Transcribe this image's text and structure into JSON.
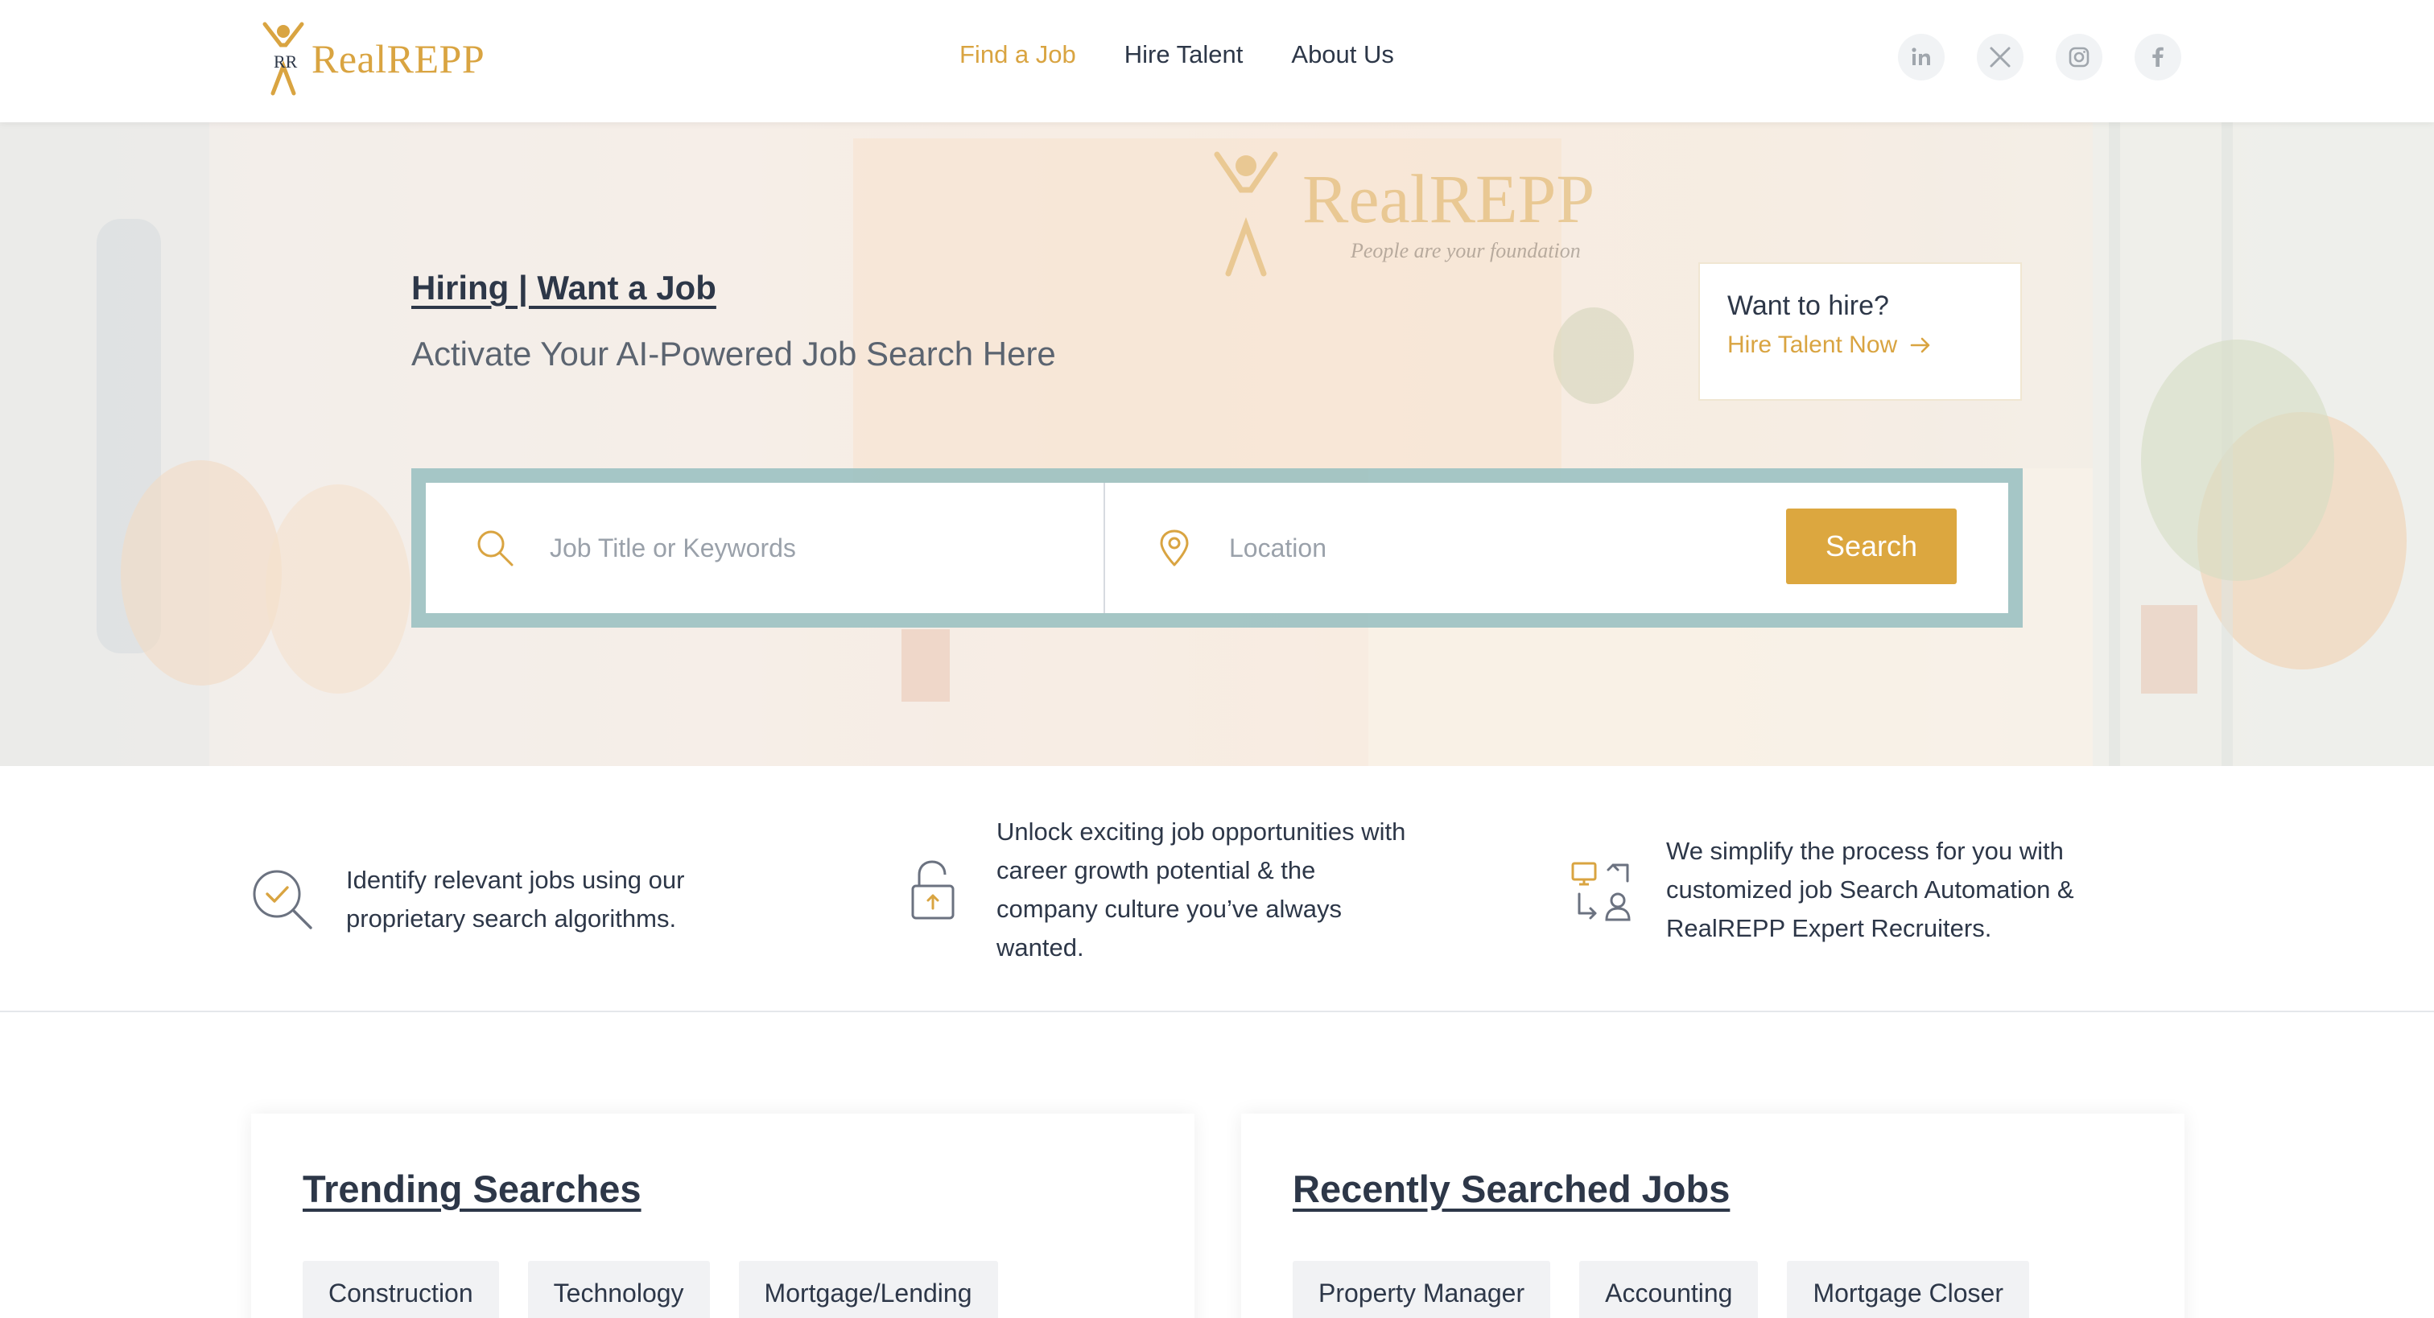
{
  "brand": {
    "name": "RealREPP",
    "primary_color": "#d9a441",
    "text_color": "#2d3748"
  },
  "nav": {
    "items": [
      {
        "label": "Find a Job",
        "active": true
      },
      {
        "label": "Hire Talent",
        "active": false
      },
      {
        "label": "About Us",
        "active": false
      }
    ]
  },
  "socials": [
    {
      "name": "linkedin-icon",
      "glyph": "in"
    },
    {
      "name": "x-twitter-icon",
      "glyph": "X"
    },
    {
      "name": "instagram-icon",
      "glyph": ""
    },
    {
      "name": "facebook-icon",
      "glyph": "f"
    }
  ],
  "hero": {
    "title": "Hiring | Want a Job",
    "subtitle": "Activate Your AI-Powered Job Search Here",
    "watermark_brand": "RealREPP",
    "watermark_tagline": "People are your foundation",
    "hire_card": {
      "title": "Want to hire?",
      "link": "Hire Talent Now"
    },
    "search": {
      "keyword_placeholder": "Job Title or Keywords",
      "location_placeholder": "Location",
      "button": "Search"
    }
  },
  "features": [
    {
      "icon": "search-check-icon",
      "lines": [
        "Identify relevant jobs using our",
        "proprietary search algorithms."
      ]
    },
    {
      "icon": "unlock-icon",
      "lines": [
        "Unlock exciting job opportunities with",
        "career growth potential & the",
        "company culture you’ve always",
        "wanted."
      ]
    },
    {
      "icon": "automation-icon",
      "lines": [
        "We simplify the process for you with",
        "customized job Search Automation &",
        "RealREPP Expert Recruiters."
      ]
    }
  ],
  "trending": {
    "title": "Trending Searches",
    "chips": [
      "Construction",
      "Technology",
      "Mortgage/Lending"
    ]
  },
  "recent": {
    "title": "Recently Searched Jobs",
    "chips": [
      "Property Manager",
      "Accounting",
      "Mortgage Closer"
    ]
  }
}
